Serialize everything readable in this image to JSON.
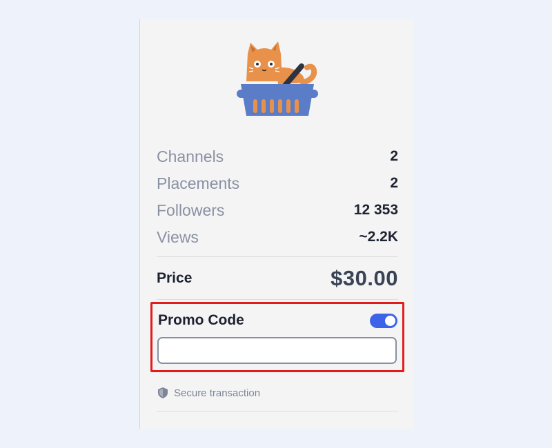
{
  "stats": [
    {
      "label": "Channels",
      "value": "2"
    },
    {
      "label": "Placements",
      "value": "2"
    },
    {
      "label": "Followers",
      "value": "12 353"
    },
    {
      "label": "Views",
      "value": "~2.2K"
    }
  ],
  "price": {
    "label": "Price",
    "value": "$30.00"
  },
  "promo": {
    "title": "Promo Code",
    "toggle_on": true,
    "input_value": "",
    "input_placeholder": ""
  },
  "secure": {
    "text": "Secure transaction",
    "icon": "shield-icon"
  },
  "mascot": {
    "icon": "cat-in-basket-icon"
  },
  "colors": {
    "accent": "#3d64e8",
    "highlight": "#e21b1b",
    "basket": "#5b7cc7",
    "cat": "#e8914a"
  }
}
